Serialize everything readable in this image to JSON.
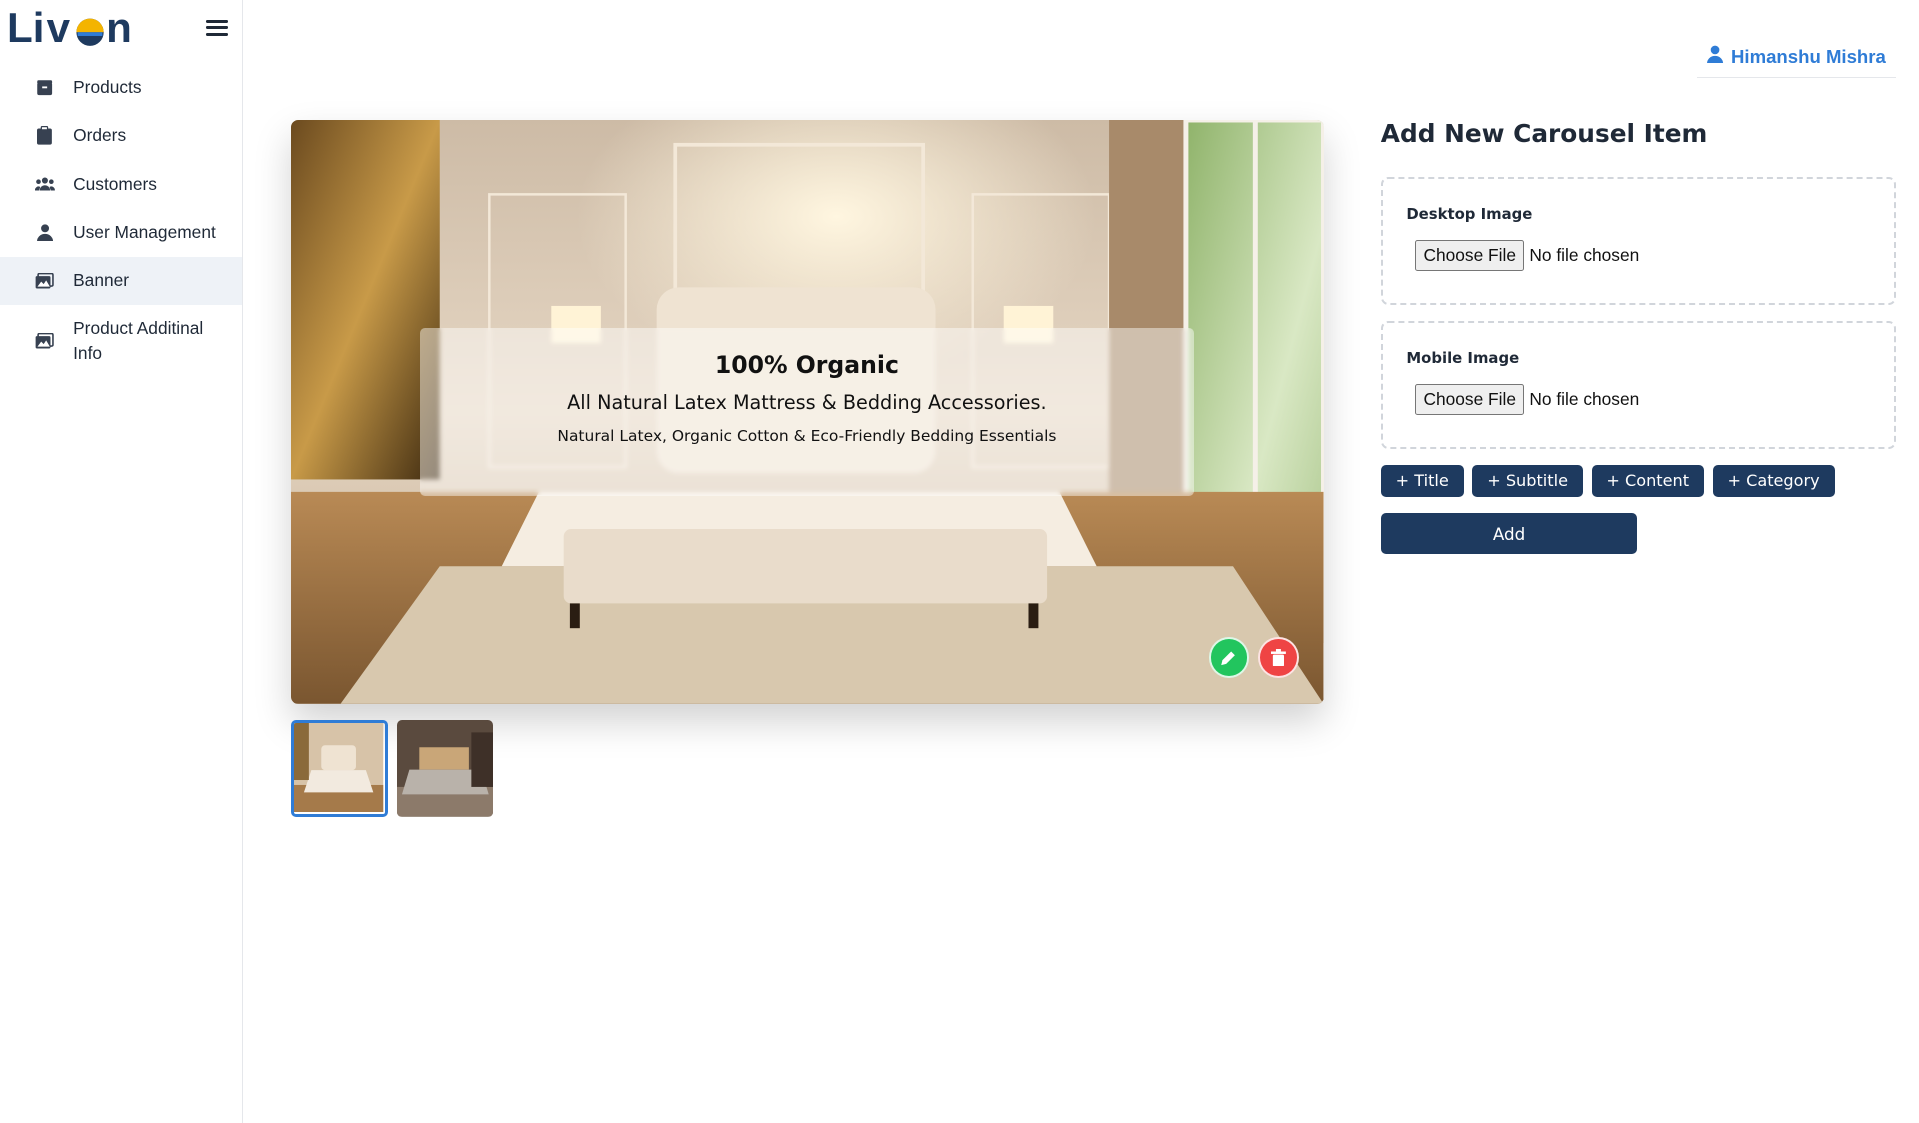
{
  "brand": {
    "logo_text": "Livon"
  },
  "sidebar": {
    "items": [
      {
        "label": "Products",
        "icon": "box-icon"
      },
      {
        "label": "Orders",
        "icon": "clipboard-icon"
      },
      {
        "label": "Customers",
        "icon": "users-icon"
      },
      {
        "label": "User Management",
        "icon": "user-icon"
      },
      {
        "label": "Banner",
        "icon": "image-icon",
        "active": true
      },
      {
        "label": "Product Additinal Info",
        "icon": "images-icon"
      }
    ]
  },
  "header": {
    "user_name": "Himanshu Mishra"
  },
  "carousel": {
    "title": "100% Organic",
    "subtitle": "All Natural Latex Mattress & Bedding Accessories.",
    "content": "Natural Latex, Organic Cotton & Eco-Friendly Bedding Essentials",
    "thumbnail_count": 2,
    "active_index": 0
  },
  "form": {
    "title": "Add New Carousel Item",
    "desktop_label": "Desktop Image",
    "mobile_label": "Mobile Image",
    "choose_file": "Choose File",
    "no_file": "No file chosen",
    "chips": [
      "+ Title",
      "+ Subtitle",
      "+ Content",
      "+ Category"
    ],
    "add_label": "Add"
  },
  "colors": {
    "primary": "#1e3a5f",
    "accent": "#2f7cd6",
    "edit": "#22c55e",
    "delete": "#ef4444"
  }
}
